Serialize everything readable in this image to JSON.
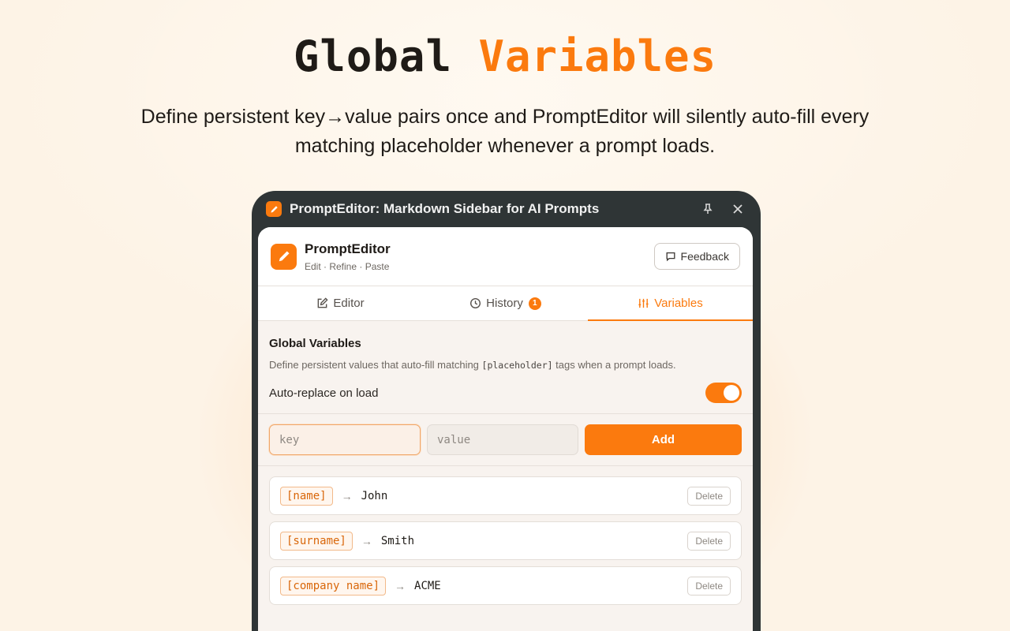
{
  "hero": {
    "title_part1": "Global",
    "title_part2": "Variables",
    "subtitle": "Define persistent key→value pairs once and PromptEditor will silently auto-fill every matching placeholder whenever a prompt loads."
  },
  "window": {
    "title": "PromptEditor: Markdown Sidebar for AI Prompts",
    "pin_icon": "pin-icon",
    "close_icon": "close-icon"
  },
  "app": {
    "name": "PromptEditor",
    "tagline": "Edit · Refine · Paste",
    "feedback_label": "Feedback"
  },
  "tabs": [
    {
      "label": "Editor",
      "icon": "edit-icon",
      "active": false
    },
    {
      "label": "History",
      "icon": "clock-icon",
      "badge": "1",
      "active": false
    },
    {
      "label": "Variables",
      "icon": "sliders-icon",
      "active": true
    }
  ],
  "variables_section": {
    "title": "Global Variables",
    "desc_before": "Define persistent values that auto-fill matching ",
    "desc_code": "[placeholder]",
    "desc_after": " tags when a prompt loads.",
    "toggle_label": "Auto-replace on load",
    "toggle_on": true
  },
  "add_form": {
    "key_placeholder": "key",
    "value_placeholder": "value",
    "add_label": "Add"
  },
  "variables": [
    {
      "key": "[name]",
      "value": "John",
      "delete_label": "Delete"
    },
    {
      "key": "[surname]",
      "value": "Smith",
      "delete_label": "Delete"
    },
    {
      "key": "[company name]",
      "value": "ACME",
      "delete_label": "Delete"
    }
  ],
  "colors": {
    "accent": "#fb7a0e",
    "titlebar": "#2f3536"
  }
}
